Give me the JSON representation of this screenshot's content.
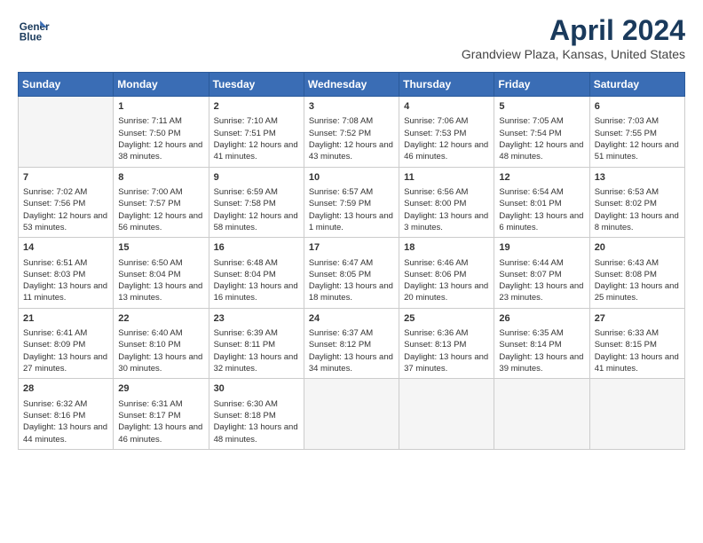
{
  "header": {
    "logo_line1": "General",
    "logo_line2": "Blue",
    "title": "April 2024",
    "subtitle": "Grandview Plaza, Kansas, United States"
  },
  "weekdays": [
    "Sunday",
    "Monday",
    "Tuesday",
    "Wednesday",
    "Thursday",
    "Friday",
    "Saturday"
  ],
  "weeks": [
    [
      {
        "day": "",
        "empty": true
      },
      {
        "day": "1",
        "sunrise": "7:11 AM",
        "sunset": "7:50 PM",
        "daylight": "12 hours and 38 minutes."
      },
      {
        "day": "2",
        "sunrise": "7:10 AM",
        "sunset": "7:51 PM",
        "daylight": "12 hours and 41 minutes."
      },
      {
        "day": "3",
        "sunrise": "7:08 AM",
        "sunset": "7:52 PM",
        "daylight": "12 hours and 43 minutes."
      },
      {
        "day": "4",
        "sunrise": "7:06 AM",
        "sunset": "7:53 PM",
        "daylight": "12 hours and 46 minutes."
      },
      {
        "day": "5",
        "sunrise": "7:05 AM",
        "sunset": "7:54 PM",
        "daylight": "12 hours and 48 minutes."
      },
      {
        "day": "6",
        "sunrise": "7:03 AM",
        "sunset": "7:55 PM",
        "daylight": "12 hours and 51 minutes."
      }
    ],
    [
      {
        "day": "7",
        "sunrise": "7:02 AM",
        "sunset": "7:56 PM",
        "daylight": "12 hours and 53 minutes."
      },
      {
        "day": "8",
        "sunrise": "7:00 AM",
        "sunset": "7:57 PM",
        "daylight": "12 hours and 56 minutes."
      },
      {
        "day": "9",
        "sunrise": "6:59 AM",
        "sunset": "7:58 PM",
        "daylight": "12 hours and 58 minutes."
      },
      {
        "day": "10",
        "sunrise": "6:57 AM",
        "sunset": "7:59 PM",
        "daylight": "13 hours and 1 minute."
      },
      {
        "day": "11",
        "sunrise": "6:56 AM",
        "sunset": "8:00 PM",
        "daylight": "13 hours and 3 minutes."
      },
      {
        "day": "12",
        "sunrise": "6:54 AM",
        "sunset": "8:01 PM",
        "daylight": "13 hours and 6 minutes."
      },
      {
        "day": "13",
        "sunrise": "6:53 AM",
        "sunset": "8:02 PM",
        "daylight": "13 hours and 8 minutes."
      }
    ],
    [
      {
        "day": "14",
        "sunrise": "6:51 AM",
        "sunset": "8:03 PM",
        "daylight": "13 hours and 11 minutes."
      },
      {
        "day": "15",
        "sunrise": "6:50 AM",
        "sunset": "8:04 PM",
        "daylight": "13 hours and 13 minutes."
      },
      {
        "day": "16",
        "sunrise": "6:48 AM",
        "sunset": "8:04 PM",
        "daylight": "13 hours and 16 minutes."
      },
      {
        "day": "17",
        "sunrise": "6:47 AM",
        "sunset": "8:05 PM",
        "daylight": "13 hours and 18 minutes."
      },
      {
        "day": "18",
        "sunrise": "6:46 AM",
        "sunset": "8:06 PM",
        "daylight": "13 hours and 20 minutes."
      },
      {
        "day": "19",
        "sunrise": "6:44 AM",
        "sunset": "8:07 PM",
        "daylight": "13 hours and 23 minutes."
      },
      {
        "day": "20",
        "sunrise": "6:43 AM",
        "sunset": "8:08 PM",
        "daylight": "13 hours and 25 minutes."
      }
    ],
    [
      {
        "day": "21",
        "sunrise": "6:41 AM",
        "sunset": "8:09 PM",
        "daylight": "13 hours and 27 minutes."
      },
      {
        "day": "22",
        "sunrise": "6:40 AM",
        "sunset": "8:10 PM",
        "daylight": "13 hours and 30 minutes."
      },
      {
        "day": "23",
        "sunrise": "6:39 AM",
        "sunset": "8:11 PM",
        "daylight": "13 hours and 32 minutes."
      },
      {
        "day": "24",
        "sunrise": "6:37 AM",
        "sunset": "8:12 PM",
        "daylight": "13 hours and 34 minutes."
      },
      {
        "day": "25",
        "sunrise": "6:36 AM",
        "sunset": "8:13 PM",
        "daylight": "13 hours and 37 minutes."
      },
      {
        "day": "26",
        "sunrise": "6:35 AM",
        "sunset": "8:14 PM",
        "daylight": "13 hours and 39 minutes."
      },
      {
        "day": "27",
        "sunrise": "6:33 AM",
        "sunset": "8:15 PM",
        "daylight": "13 hours and 41 minutes."
      }
    ],
    [
      {
        "day": "28",
        "sunrise": "6:32 AM",
        "sunset": "8:16 PM",
        "daylight": "13 hours and 44 minutes."
      },
      {
        "day": "29",
        "sunrise": "6:31 AM",
        "sunset": "8:17 PM",
        "daylight": "13 hours and 46 minutes."
      },
      {
        "day": "30",
        "sunrise": "6:30 AM",
        "sunset": "8:18 PM",
        "daylight": "13 hours and 48 minutes."
      },
      {
        "day": "",
        "empty": true
      },
      {
        "day": "",
        "empty": true
      },
      {
        "day": "",
        "empty": true
      },
      {
        "day": "",
        "empty": true
      }
    ]
  ]
}
